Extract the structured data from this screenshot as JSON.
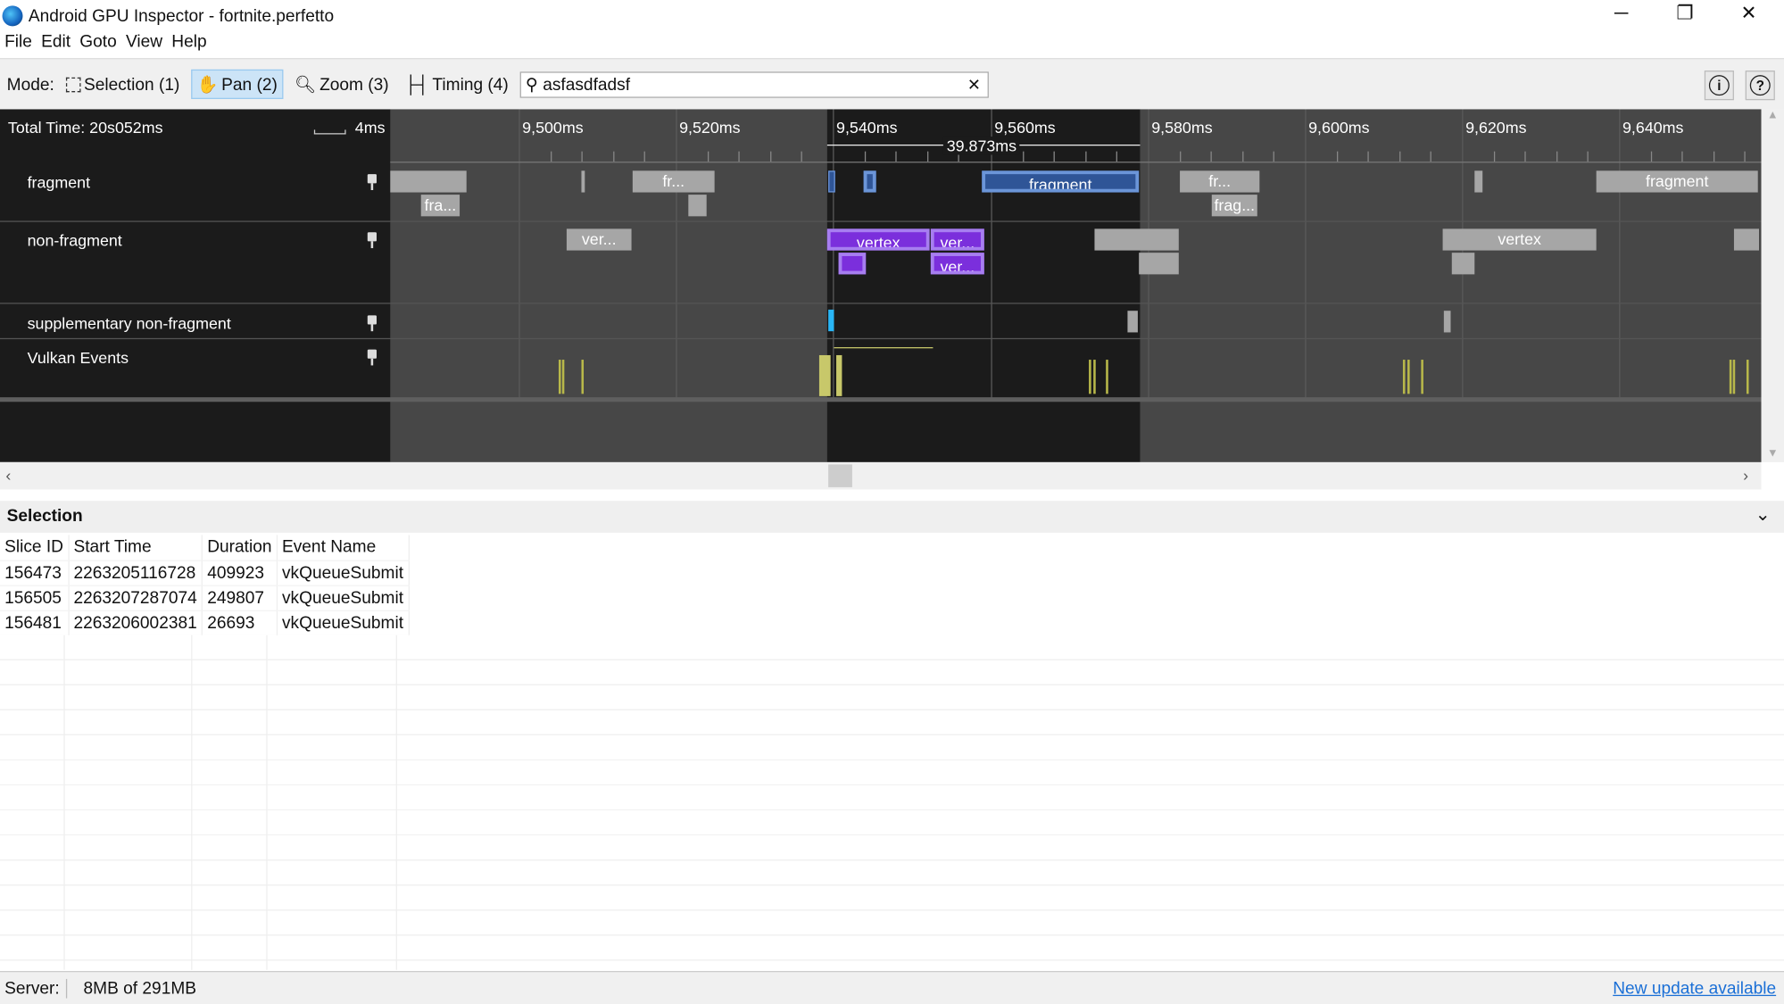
{
  "window": {
    "title": "Android GPU Inspector - fortnite.perfetto",
    "minimize": "─",
    "restore": "❐",
    "close": "✕"
  },
  "menu": [
    "File",
    "Edit",
    "Goto",
    "View",
    "Help"
  ],
  "toolbar": {
    "mode_label": "Mode:",
    "modes": [
      {
        "label": "Selection (1)",
        "icon": "selection-icon"
      },
      {
        "label": "Pan (2)",
        "icon": "hand-icon",
        "active": true
      },
      {
        "label": "Zoom (3)",
        "icon": "zoom-icon"
      },
      {
        "label": "Timing (4)",
        "icon": "timing-icon"
      }
    ],
    "search_value": "asfasdfadsf",
    "info": "i",
    "help": "?"
  },
  "timeline": {
    "total_time": "Total Time: 20s052ms",
    "scale": "4ms",
    "ticks": [
      "9,500ms",
      "9,520ms",
      "9,540ms",
      "9,560ms",
      "9,580ms",
      "9,600ms",
      "9,620ms",
      "9,640ms"
    ],
    "selection_duration": "39.873ms",
    "tracks": [
      "fragment",
      "non-fragment",
      "supplementary non-fragment",
      "Vulkan Events"
    ],
    "slice_labels": {
      "fra": "fra...",
      "fr": "fr...",
      "fragment": "fragment",
      "frag": "frag...",
      "ver": "ver...",
      "vertex": "vertex"
    }
  },
  "selection": {
    "title": "Selection",
    "columns": [
      "Slice ID",
      "Start Time",
      "Duration",
      "Event Name"
    ],
    "rows": [
      [
        "156473",
        "2263205116728",
        "409923",
        "vkQueueSubmit"
      ],
      [
        "156505",
        "2263207287074",
        "249807",
        "vkQueueSubmit"
      ],
      [
        "156481",
        "2263206002381",
        "26693",
        "vkQueueSubmit"
      ]
    ]
  },
  "status": {
    "server_label": "Server:",
    "memory": "8MB of 291MB",
    "update_link": "New update available"
  },
  "colors": {
    "accent": "#cce4f7",
    "fragment_selected": "#2f5597",
    "vertex_selected": "#7b2fdc",
    "vulkan": "#c8c86a",
    "link": "#1a6fd6"
  }
}
